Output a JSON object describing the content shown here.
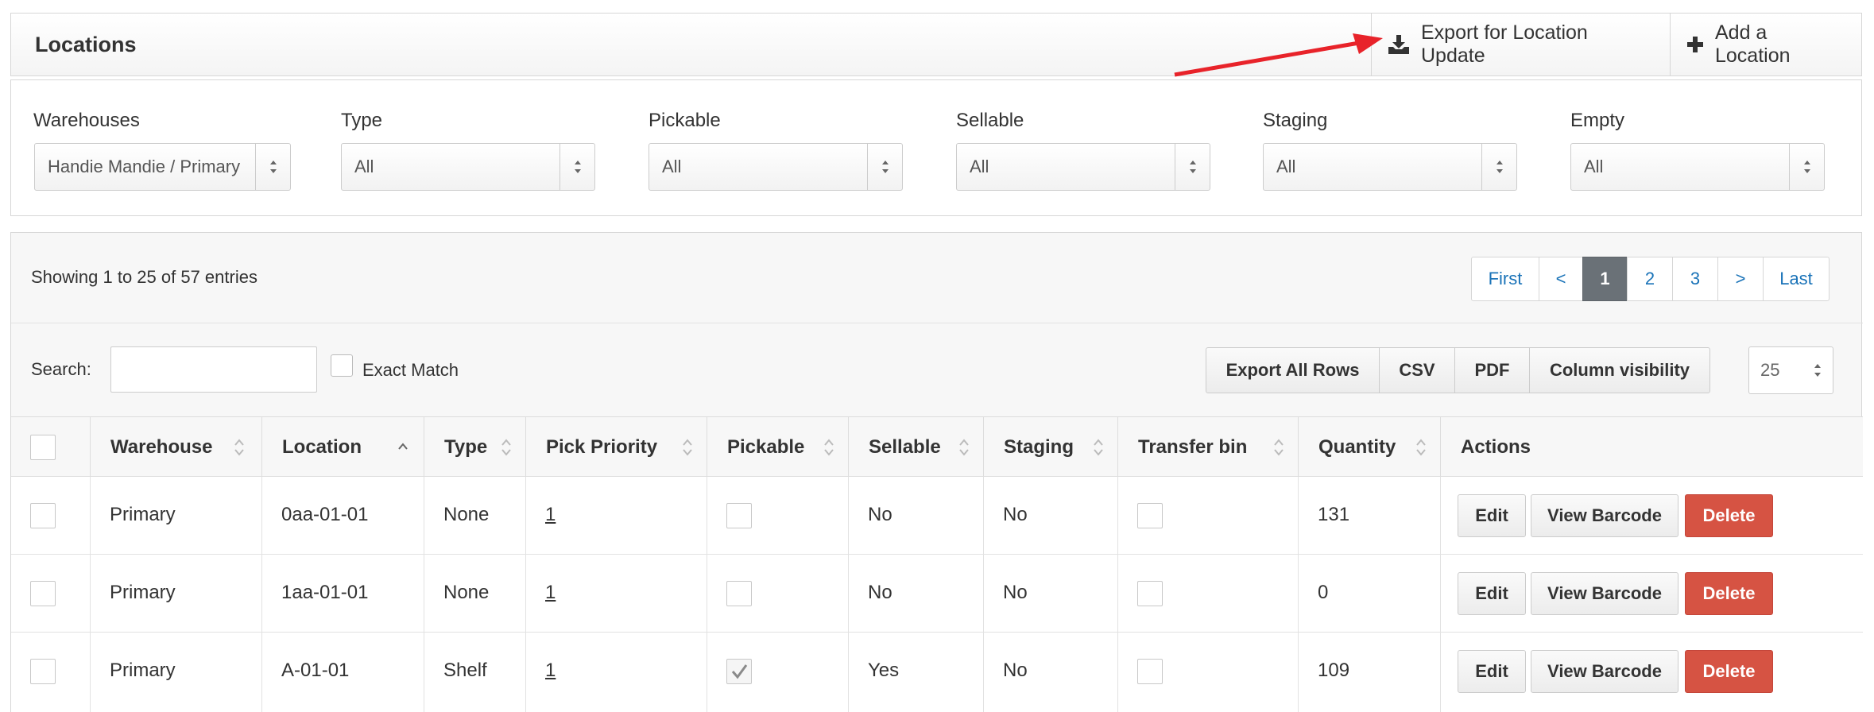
{
  "header": {
    "title": "Locations",
    "export_label": "Export for Location Update",
    "add_label": "Add a Location"
  },
  "filters": [
    {
      "label": "Warehouses",
      "value": "Handie Mandie / Primary"
    },
    {
      "label": "Type",
      "value": "All"
    },
    {
      "label": "Pickable",
      "value": "All"
    },
    {
      "label": "Sellable",
      "value": "All"
    },
    {
      "label": "Staging",
      "value": "All"
    },
    {
      "label": "Empty",
      "value": "All"
    }
  ],
  "table_info": "Showing 1 to 25 of 57 entries",
  "pagination": [
    "First",
    "<",
    "1",
    "2",
    "3",
    ">",
    "Last"
  ],
  "pagination_active": "1",
  "search": {
    "label": "Search:",
    "value": "",
    "exact_match_label": "Exact Match"
  },
  "export_buttons": [
    "Export All Rows",
    "CSV",
    "PDF",
    "Column visibility"
  ],
  "page_length": "25",
  "columns": [
    "Warehouse",
    "Location",
    "Type",
    "Pick Priority",
    "Pickable",
    "Sellable",
    "Staging",
    "Transfer bin",
    "Quantity",
    "Actions"
  ],
  "rows": [
    {
      "warehouse": "Primary",
      "location": "0aa-01-01",
      "type": "None",
      "pick_priority": "1",
      "pickable": false,
      "sellable": "No",
      "staging": "No",
      "transfer_bin": false,
      "quantity": "131"
    },
    {
      "warehouse": "Primary",
      "location": "1aa-01-01",
      "type": "None",
      "pick_priority": "1",
      "pickable": false,
      "sellable": "No",
      "staging": "No",
      "transfer_bin": false,
      "quantity": "0"
    },
    {
      "warehouse": "Primary",
      "location": "A-01-01",
      "type": "Shelf",
      "pick_priority": "1",
      "pickable": true,
      "sellable": "Yes",
      "staging": "No",
      "transfer_bin": false,
      "quantity": "109"
    }
  ],
  "actions": {
    "edit": "Edit",
    "barcode": "View Barcode",
    "delete": "Delete"
  },
  "colors": {
    "accent_link": "#1a73b8",
    "danger": "#d65343",
    "annotation_arrow": "#e8232a",
    "active_page": "#6a7177"
  }
}
